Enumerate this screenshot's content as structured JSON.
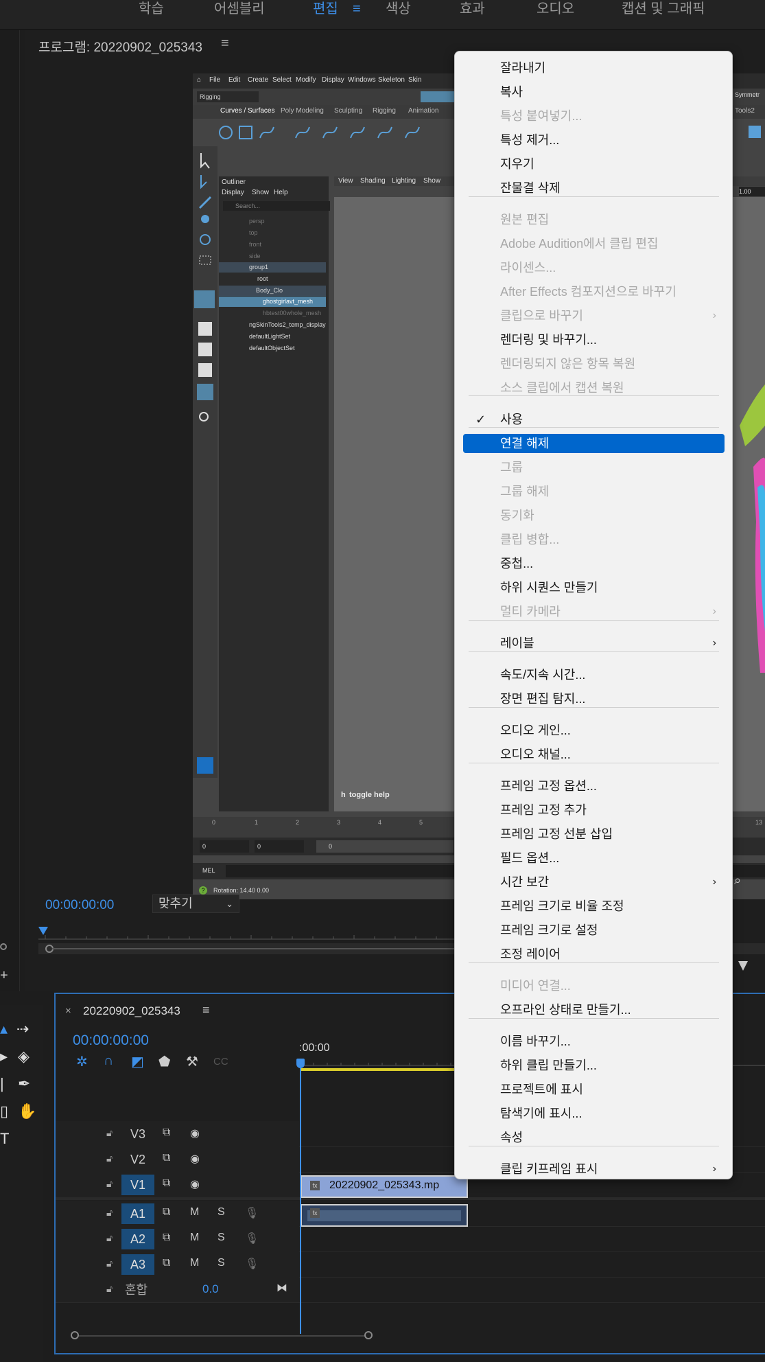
{
  "workspace_tabs": [
    "학습",
    "어셈블리",
    "편집",
    "색상",
    "효과",
    "오디오",
    "캡션 및 그래픽"
  ],
  "workspace_active": "편집",
  "workspace_menu_icon": "hamburger-icon",
  "program_monitor": {
    "title": "프로그램: 20220902_025343",
    "timecode": "00:00:00:00",
    "fit_option": "맞추기"
  },
  "maya": {
    "menus": [
      "File",
      "Edit",
      "Create",
      "Select",
      "Modify",
      "Display",
      "Windows",
      "Skeleton",
      "Skin"
    ],
    "mode": "Rigging",
    "shelf_tabs": [
      "Curves / Surfaces",
      "Poly Modeling",
      "Sculpting",
      "Rigging",
      "Animation"
    ],
    "outliner_title": "Outliner",
    "outliner_menus": [
      "Display",
      "Show",
      "Help"
    ],
    "outliner_search": "Search...",
    "outliner_items": [
      "persp",
      "top",
      "front",
      "side",
      "group1",
      "root",
      "Body_Clo",
      "ghostgirlavt_mesh",
      "hbtest00whole_mesh",
      "ngSkinTools2_temp_display",
      "defaultLightSet",
      "defaultObjectSet"
    ],
    "viewport_menus": [
      "View",
      "Shading",
      "Lighting",
      "Show"
    ],
    "toggle_help": "toggle help",
    "axis_label": "h",
    "timeline_numbers": [
      "0",
      "1",
      "2",
      "3",
      "4",
      "5"
    ],
    "range_start": "0",
    "range_end": "0",
    "range_box": "0",
    "mel_label": "MEL",
    "help_line": "Rotation:   14.40      0.00",
    "right_label_1": "Symmetr",
    "right_label_2": "Tools2",
    "right_num": "1.00",
    "right_ts": "13"
  },
  "timeline": {
    "sequence_name": "20220902_025343",
    "timecode": "00:00:00:00",
    "ruler_start": ":00:00",
    "tracks_video": [
      {
        "name": "V3",
        "targeted": false
      },
      {
        "name": "V2",
        "targeted": false
      },
      {
        "name": "V1",
        "targeted": true
      }
    ],
    "tracks_audio": [
      {
        "name": "A1",
        "targeted": true
      },
      {
        "name": "A2",
        "targeted": true
      },
      {
        "name": "A3",
        "targeted": true
      }
    ],
    "mix_label": "혼합",
    "mix_value": "0.0",
    "clip_name": "20220902_025343.mp",
    "audio_mute": "M",
    "audio_solo": "S"
  },
  "context_menu": {
    "items": [
      {
        "label": "잘라내기",
        "enabled": true
      },
      {
        "label": "복사",
        "enabled": true
      },
      {
        "label": "특성 붙여넣기...",
        "enabled": false
      },
      {
        "label": "특성 제거...",
        "enabled": true
      },
      {
        "label": "지우기",
        "enabled": true
      },
      {
        "label": "잔물결 삭제",
        "enabled": true
      },
      {
        "label": "원본 편집",
        "enabled": false
      },
      {
        "label": "Adobe Audition에서 클립 편집",
        "enabled": false
      },
      {
        "label": "라이센스...",
        "enabled": false
      },
      {
        "label": "After Effects 컴포지션으로 바꾸기",
        "enabled": false
      },
      {
        "label": "클립으로 바꾸기",
        "enabled": false,
        "submenu": true
      },
      {
        "label": "렌더링 및 바꾸기...",
        "enabled": true
      },
      {
        "label": "렌더링되지 않은 항목 복원",
        "enabled": false
      },
      {
        "label": "소스 클립에서 캡션 복원",
        "enabled": false
      },
      {
        "label": "사용",
        "enabled": true,
        "checked": true
      },
      {
        "label": "연결 해제",
        "enabled": true,
        "selected": true
      },
      {
        "label": "그룹",
        "enabled": false
      },
      {
        "label": "그룹 해제",
        "enabled": false
      },
      {
        "label": "동기화",
        "enabled": false
      },
      {
        "label": "클립 병합...",
        "enabled": false
      },
      {
        "label": "중첩...",
        "enabled": true
      },
      {
        "label": "하위 시퀀스 만들기",
        "enabled": true
      },
      {
        "label": "멀티 카메라",
        "enabled": false,
        "submenu": true
      },
      {
        "label": "레이블",
        "enabled": true,
        "submenu": true
      },
      {
        "label": "속도/지속 시간...",
        "enabled": true
      },
      {
        "label": "장면 편집 탐지...",
        "enabled": true
      },
      {
        "label": "오디오 게인...",
        "enabled": true
      },
      {
        "label": "오디오 채널...",
        "enabled": true
      },
      {
        "label": "프레임 고정 옵션...",
        "enabled": true
      },
      {
        "label": "프레임 고정 추가",
        "enabled": true
      },
      {
        "label": "프레임 고정 선분 삽입",
        "enabled": true
      },
      {
        "label": "필드 옵션...",
        "enabled": true
      },
      {
        "label": "시간 보간",
        "enabled": true,
        "submenu": true
      },
      {
        "label": "프레임 크기로 비율 조정",
        "enabled": true
      },
      {
        "label": "프레임 크기로 설정",
        "enabled": true
      },
      {
        "label": "조정 레이어",
        "enabled": true
      },
      {
        "label": "미디어 연결...",
        "enabled": false
      },
      {
        "label": "오프라인 상태로 만들기...",
        "enabled": true
      },
      {
        "label": "이름 바꾸기...",
        "enabled": true
      },
      {
        "label": "하위 클립 만들기...",
        "enabled": true
      },
      {
        "label": "프로젝트에 표시",
        "enabled": true
      },
      {
        "label": "탐색기에 표시...",
        "enabled": true
      },
      {
        "label": "속성",
        "enabled": true
      },
      {
        "label": "클립 키프레임 표시",
        "enabled": true,
        "submenu": true
      }
    ],
    "check_glyph": "✓",
    "submenu_glyph": "›"
  },
  "colors": {
    "accent": "#3d8fe8",
    "menu_selected": "#0066cc",
    "clip_video": "#8ba3d6",
    "clip_audio": "#2e4160",
    "work_area": "#d9cc2b"
  }
}
